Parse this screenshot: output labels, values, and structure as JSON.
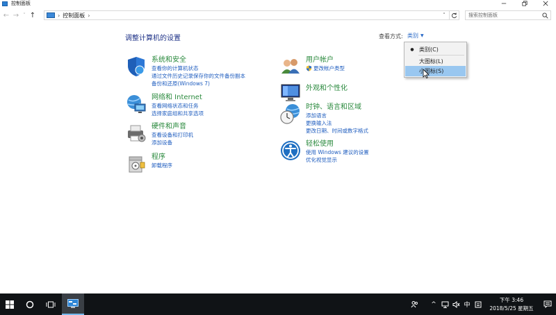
{
  "window": {
    "title": "控制面板"
  },
  "address": {
    "breadcrumb": "控制面板",
    "separator": "›"
  },
  "search": {
    "placeholder": "搜索控制面板"
  },
  "main": {
    "heading": "调整计算机的设置",
    "view_by_label": "查看方式:",
    "view_by_value": "类别"
  },
  "categories": {
    "system": {
      "title": "系统和安全",
      "links": [
        "查看你的计算机状态",
        "通过文件历史记录保存你的文件备份副本",
        "备份和还原(Windows 7)"
      ]
    },
    "network": {
      "title": "网络和 Internet",
      "links": [
        "查看网络状态和任务",
        "选择家庭组和共享选项"
      ]
    },
    "hardware": {
      "title": "硬件和声音",
      "links": [
        "查看设备和打印机",
        "添加设备"
      ]
    },
    "programs": {
      "title": "程序",
      "links": [
        "卸载程序"
      ]
    },
    "users": {
      "title": "用户帐户",
      "links": [
        "更改帐户类型"
      ]
    },
    "appearance": {
      "title": "外观和个性化",
      "links": []
    },
    "clock": {
      "title": "时钟、语言和区域",
      "links": [
        "添加语言",
        "更换输入法",
        "更改日期、时间或数字格式"
      ]
    },
    "ease": {
      "title": "轻松使用",
      "links": [
        "使用 Windows 建议的设置",
        "优化视觉显示"
      ]
    }
  },
  "menu": {
    "items": [
      {
        "label": "类别(C)",
        "selected": true
      },
      {
        "label": "大图标(L)",
        "selected": false
      },
      {
        "label": "小图标(S)",
        "selected": false,
        "highlighted": true
      }
    ],
    "bullet": "●"
  },
  "taskbar": {
    "time": "下午 3:46",
    "date": "2018/5/25 星期五",
    "ime": "中",
    "tray_chevron": "^"
  },
  "colors": {
    "category_title": "#2b8a3e",
    "link": "#1f5dbf",
    "heading": "#1e3287",
    "menu_highlight": "#99c7f0",
    "taskbar": "#101316"
  }
}
